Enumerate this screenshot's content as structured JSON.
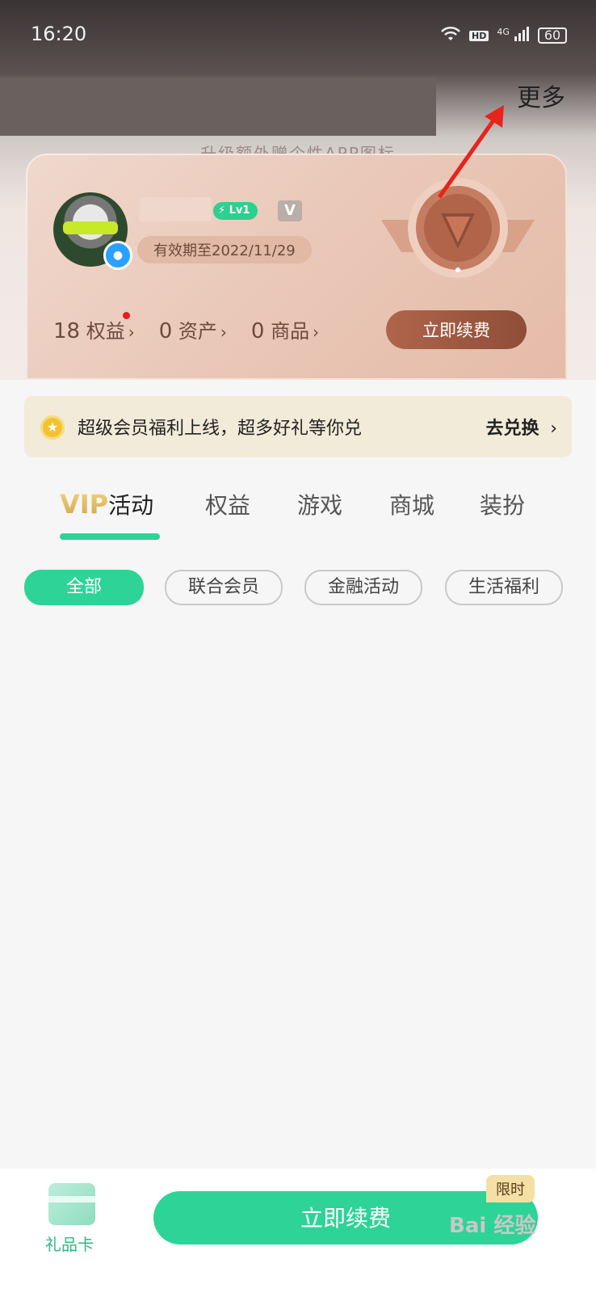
{
  "status_bar": {
    "time": "16:20",
    "hd": "HD",
    "network": "4G",
    "battery": "60"
  },
  "header": {
    "more_label": "更多",
    "subtitle": "— 升级额外赠个性APP图标 —"
  },
  "member_card": {
    "level": "Lv1",
    "v_badge": "V",
    "expiry": "有效期至2022/11/29",
    "stats": [
      {
        "count": "18",
        "label": "权益"
      },
      {
        "count": "0",
        "label": "资产"
      },
      {
        "count": "0",
        "label": "商品"
      }
    ],
    "renew_label": "立即续费"
  },
  "notice": {
    "text": "超级会员福利上线，超多好礼等你兑",
    "action": "去兑换"
  },
  "tabs": {
    "vip_prefix": "VIP",
    "items": [
      "活动",
      "权益",
      "游戏",
      "商城",
      "装扮"
    ],
    "active_index": 0
  },
  "chips": {
    "items": [
      "全部",
      "联合会员",
      "金融活动",
      "生活福利"
    ],
    "active_index": 0
  },
  "bottom_bar": {
    "gift_label": "礼品卡",
    "renew_label": "立即续费",
    "limited_tag": "限时"
  },
  "watermark": "Bai 经验",
  "colors": {
    "accent": "#2ed397",
    "card_button": "#9d573f",
    "notice_bg": "#f3ebd9",
    "annotation_arrow": "#e8231c"
  }
}
